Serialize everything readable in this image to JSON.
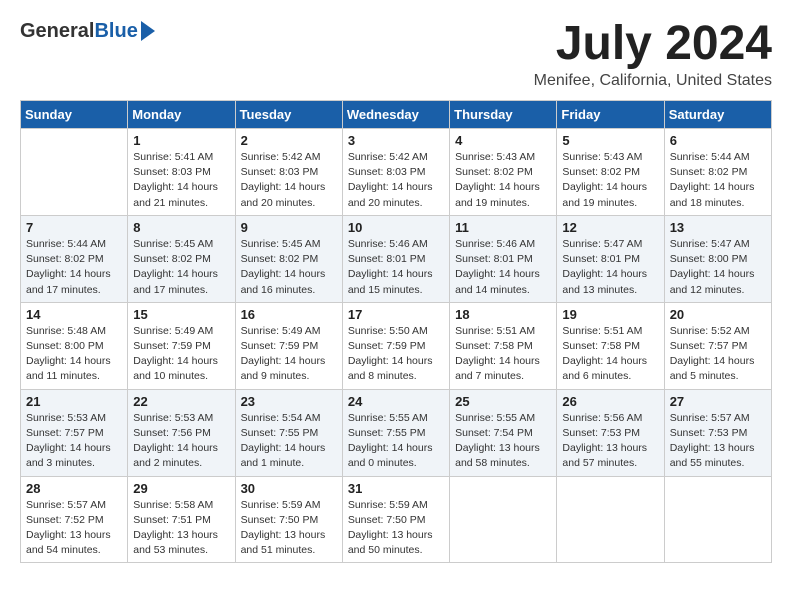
{
  "header": {
    "logo_general": "General",
    "logo_blue": "Blue",
    "month_title": "July 2024",
    "location": "Menifee, California, United States"
  },
  "days_of_week": [
    "Sunday",
    "Monday",
    "Tuesday",
    "Wednesday",
    "Thursday",
    "Friday",
    "Saturday"
  ],
  "weeks": [
    [
      {
        "day": "",
        "info": ""
      },
      {
        "day": "1",
        "info": "Sunrise: 5:41 AM\nSunset: 8:03 PM\nDaylight: 14 hours\nand 21 minutes."
      },
      {
        "day": "2",
        "info": "Sunrise: 5:42 AM\nSunset: 8:03 PM\nDaylight: 14 hours\nand 20 minutes."
      },
      {
        "day": "3",
        "info": "Sunrise: 5:42 AM\nSunset: 8:03 PM\nDaylight: 14 hours\nand 20 minutes."
      },
      {
        "day": "4",
        "info": "Sunrise: 5:43 AM\nSunset: 8:02 PM\nDaylight: 14 hours\nand 19 minutes."
      },
      {
        "day": "5",
        "info": "Sunrise: 5:43 AM\nSunset: 8:02 PM\nDaylight: 14 hours\nand 19 minutes."
      },
      {
        "day": "6",
        "info": "Sunrise: 5:44 AM\nSunset: 8:02 PM\nDaylight: 14 hours\nand 18 minutes."
      }
    ],
    [
      {
        "day": "7",
        "info": "Sunrise: 5:44 AM\nSunset: 8:02 PM\nDaylight: 14 hours\nand 17 minutes."
      },
      {
        "day": "8",
        "info": "Sunrise: 5:45 AM\nSunset: 8:02 PM\nDaylight: 14 hours\nand 17 minutes."
      },
      {
        "day": "9",
        "info": "Sunrise: 5:45 AM\nSunset: 8:02 PM\nDaylight: 14 hours\nand 16 minutes."
      },
      {
        "day": "10",
        "info": "Sunrise: 5:46 AM\nSunset: 8:01 PM\nDaylight: 14 hours\nand 15 minutes."
      },
      {
        "day": "11",
        "info": "Sunrise: 5:46 AM\nSunset: 8:01 PM\nDaylight: 14 hours\nand 14 minutes."
      },
      {
        "day": "12",
        "info": "Sunrise: 5:47 AM\nSunset: 8:01 PM\nDaylight: 14 hours\nand 13 minutes."
      },
      {
        "day": "13",
        "info": "Sunrise: 5:47 AM\nSunset: 8:00 PM\nDaylight: 14 hours\nand 12 minutes."
      }
    ],
    [
      {
        "day": "14",
        "info": "Sunrise: 5:48 AM\nSunset: 8:00 PM\nDaylight: 14 hours\nand 11 minutes."
      },
      {
        "day": "15",
        "info": "Sunrise: 5:49 AM\nSunset: 7:59 PM\nDaylight: 14 hours\nand 10 minutes."
      },
      {
        "day": "16",
        "info": "Sunrise: 5:49 AM\nSunset: 7:59 PM\nDaylight: 14 hours\nand 9 minutes."
      },
      {
        "day": "17",
        "info": "Sunrise: 5:50 AM\nSunset: 7:59 PM\nDaylight: 14 hours\nand 8 minutes."
      },
      {
        "day": "18",
        "info": "Sunrise: 5:51 AM\nSunset: 7:58 PM\nDaylight: 14 hours\nand 7 minutes."
      },
      {
        "day": "19",
        "info": "Sunrise: 5:51 AM\nSunset: 7:58 PM\nDaylight: 14 hours\nand 6 minutes."
      },
      {
        "day": "20",
        "info": "Sunrise: 5:52 AM\nSunset: 7:57 PM\nDaylight: 14 hours\nand 5 minutes."
      }
    ],
    [
      {
        "day": "21",
        "info": "Sunrise: 5:53 AM\nSunset: 7:57 PM\nDaylight: 14 hours\nand 3 minutes."
      },
      {
        "day": "22",
        "info": "Sunrise: 5:53 AM\nSunset: 7:56 PM\nDaylight: 14 hours\nand 2 minutes."
      },
      {
        "day": "23",
        "info": "Sunrise: 5:54 AM\nSunset: 7:55 PM\nDaylight: 14 hours\nand 1 minute."
      },
      {
        "day": "24",
        "info": "Sunrise: 5:55 AM\nSunset: 7:55 PM\nDaylight: 14 hours\nand 0 minutes."
      },
      {
        "day": "25",
        "info": "Sunrise: 5:55 AM\nSunset: 7:54 PM\nDaylight: 13 hours\nand 58 minutes."
      },
      {
        "day": "26",
        "info": "Sunrise: 5:56 AM\nSunset: 7:53 PM\nDaylight: 13 hours\nand 57 minutes."
      },
      {
        "day": "27",
        "info": "Sunrise: 5:57 AM\nSunset: 7:53 PM\nDaylight: 13 hours\nand 55 minutes."
      }
    ],
    [
      {
        "day": "28",
        "info": "Sunrise: 5:57 AM\nSunset: 7:52 PM\nDaylight: 13 hours\nand 54 minutes."
      },
      {
        "day": "29",
        "info": "Sunrise: 5:58 AM\nSunset: 7:51 PM\nDaylight: 13 hours\nand 53 minutes."
      },
      {
        "day": "30",
        "info": "Sunrise: 5:59 AM\nSunset: 7:50 PM\nDaylight: 13 hours\nand 51 minutes."
      },
      {
        "day": "31",
        "info": "Sunrise: 5:59 AM\nSunset: 7:50 PM\nDaylight: 13 hours\nand 50 minutes."
      },
      {
        "day": "",
        "info": ""
      },
      {
        "day": "",
        "info": ""
      },
      {
        "day": "",
        "info": ""
      }
    ]
  ]
}
